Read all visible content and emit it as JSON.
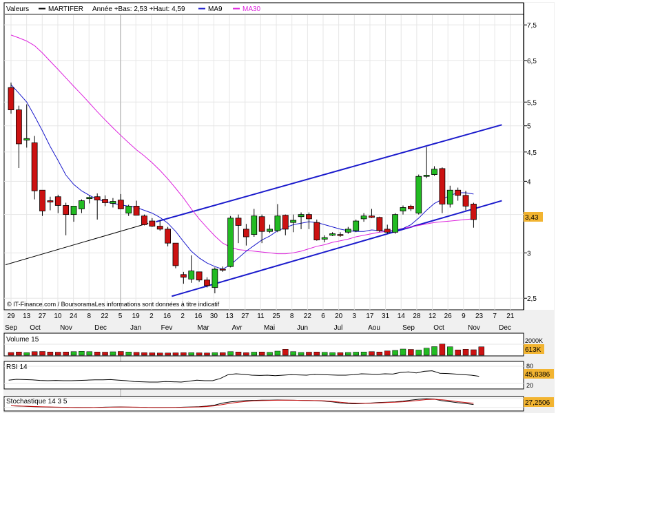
{
  "header": {
    "valeurs_label": "Valeurs",
    "symbol": "MARTIFER",
    "range_text": "Année +Bas: 2,53 +Haut: 4,59",
    "ma9_label": "MA9",
    "ma30_label": "MA30"
  },
  "colors": {
    "up": "#22bb22",
    "down": "#cc1111",
    "ma9": "#1a1acc",
    "ma30": "#dd22dd",
    "channel": "#1a1acc",
    "grid": "#e6e6e6",
    "badge_bg": "#f2b431",
    "panel_bg": "#ffffff",
    "frame_bg": "#f0f0f0"
  },
  "copyright": "© IT-Finance.com / BoursoramaLes informations sont données à titre indicatif",
  "price_axis": {
    "ticks": [
      2.5,
      3,
      3.5,
      4,
      4.5,
      5,
      5.5,
      6.5,
      7.5
    ],
    "labels": [
      "2,5",
      "3",
      "",
      "4",
      "4,5",
      "5",
      "5,5",
      "6,5",
      "7,5"
    ],
    "scale": "log",
    "last_value_label": "3,43"
  },
  "time_axis": {
    "day_labels": [
      "29",
      "13",
      "27",
      "10",
      "24",
      "8",
      "22",
      "5",
      "19",
      "2",
      "16",
      "2",
      "16",
      "30",
      "13",
      "27",
      "11",
      "25",
      "8",
      "22",
      "6",
      "20",
      "3",
      "17",
      "31",
      "14",
      "28",
      "12",
      "26",
      "9",
      "23",
      "7",
      "21"
    ],
    "month_labels": [
      "Sep",
      "Oct",
      "Nov",
      "Dec",
      "Jan",
      "Fev",
      "Mar",
      "Avr",
      "Mai",
      "Jun",
      "Jul",
      "Aou",
      "Sep",
      "Oct",
      "Nov",
      "Dec"
    ]
  },
  "chart_data": {
    "type": "candlestick",
    "title": "MARTIFER",
    "subtitle": "Année +Bas: 2,53 +Haut: 4,59",
    "ylim": [
      2.4,
      7.8
    ],
    "yscale": "log",
    "candles": [
      {
        "o": 5.83,
        "h": 5.95,
        "l": 5.25,
        "c": 5.33
      },
      {
        "o": 5.33,
        "h": 5.42,
        "l": 4.22,
        "c": 4.65
      },
      {
        "o": 4.72,
        "h": 5.45,
        "l": 4.58,
        "c": 4.75
      },
      {
        "o": 4.67,
        "h": 4.8,
        "l": 3.72,
        "c": 3.85
      },
      {
        "o": 3.86,
        "h": 3.86,
        "l": 3.48,
        "c": 3.55
      },
      {
        "o": 3.7,
        "h": 3.76,
        "l": 3.56,
        "c": 3.68
      },
      {
        "o": 3.76,
        "h": 3.79,
        "l": 3.52,
        "c": 3.63
      },
      {
        "o": 3.63,
        "h": 3.67,
        "l": 3.22,
        "c": 3.5
      },
      {
        "o": 3.5,
        "h": 3.6,
        "l": 3.4,
        "c": 3.62
      },
      {
        "o": 3.58,
        "h": 3.72,
        "l": 3.52,
        "c": 3.7
      },
      {
        "o": 3.73,
        "h": 3.78,
        "l": 3.66,
        "c": 3.75
      },
      {
        "o": 3.76,
        "h": 3.81,
        "l": 3.43,
        "c": 3.71
      },
      {
        "o": 3.72,
        "h": 3.78,
        "l": 3.62,
        "c": 3.67
      },
      {
        "o": 3.66,
        "h": 3.74,
        "l": 3.6,
        "c": 3.69
      },
      {
        "o": 3.71,
        "h": 3.8,
        "l": 3.58,
        "c": 3.58
      },
      {
        "o": 3.52,
        "h": 3.64,
        "l": 3.48,
        "c": 3.62
      },
      {
        "o": 3.62,
        "h": 3.7,
        "l": 3.52,
        "c": 3.49
      },
      {
        "o": 3.48,
        "h": 3.5,
        "l": 3.35,
        "c": 3.36
      },
      {
        "o": 3.41,
        "h": 3.45,
        "l": 3.33,
        "c": 3.34
      },
      {
        "o": 3.34,
        "h": 3.42,
        "l": 3.28,
        "c": 3.3
      },
      {
        "o": 3.3,
        "h": 3.33,
        "l": 3.08,
        "c": 3.12
      },
      {
        "o": 3.12,
        "h": 3.12,
        "l": 2.82,
        "c": 2.85
      },
      {
        "o": 2.75,
        "h": 2.78,
        "l": 2.65,
        "c": 2.72
      },
      {
        "o": 2.7,
        "h": 2.97,
        "l": 2.66,
        "c": 2.79
      },
      {
        "o": 2.78,
        "h": 2.78,
        "l": 2.67,
        "c": 2.69
      },
      {
        "o": 2.69,
        "h": 2.72,
        "l": 2.61,
        "c": 2.63
      },
      {
        "o": 2.61,
        "h": 2.83,
        "l": 2.55,
        "c": 2.81
      },
      {
        "o": 2.81,
        "h": 2.84,
        "l": 2.78,
        "c": 2.8
      },
      {
        "o": 2.84,
        "h": 3.48,
        "l": 2.83,
        "c": 3.45
      },
      {
        "o": 3.45,
        "h": 3.5,
        "l": 3.12,
        "c": 3.35
      },
      {
        "o": 3.3,
        "h": 3.37,
        "l": 3.09,
        "c": 3.2
      },
      {
        "o": 3.23,
        "h": 3.58,
        "l": 3.2,
        "c": 3.48
      },
      {
        "o": 3.47,
        "h": 3.5,
        "l": 3.12,
        "c": 3.27
      },
      {
        "o": 3.27,
        "h": 3.36,
        "l": 3.25,
        "c": 3.3
      },
      {
        "o": 3.28,
        "h": 3.65,
        "l": 3.26,
        "c": 3.48
      },
      {
        "o": 3.49,
        "h": 3.5,
        "l": 3.22,
        "c": 3.3
      },
      {
        "o": 3.39,
        "h": 3.5,
        "l": 3.26,
        "c": 3.42
      },
      {
        "o": 3.47,
        "h": 3.53,
        "l": 3.3,
        "c": 3.5
      },
      {
        "o": 3.5,
        "h": 3.53,
        "l": 3.3,
        "c": 3.44
      },
      {
        "o": 3.39,
        "h": 3.43,
        "l": 3.15,
        "c": 3.16
      },
      {
        "o": 3.17,
        "h": 3.22,
        "l": 3.13,
        "c": 3.19
      },
      {
        "o": 3.22,
        "h": 3.26,
        "l": 3.21,
        "c": 3.24
      },
      {
        "o": 3.23,
        "h": 3.26,
        "l": 3.2,
        "c": 3.22
      },
      {
        "o": 3.26,
        "h": 3.33,
        "l": 3.24,
        "c": 3.3
      },
      {
        "o": 3.28,
        "h": 3.43,
        "l": 3.26,
        "c": 3.41
      },
      {
        "o": 3.44,
        "h": 3.52,
        "l": 3.4,
        "c": 3.48
      },
      {
        "o": 3.48,
        "h": 3.58,
        "l": 3.45,
        "c": 3.46
      },
      {
        "o": 3.46,
        "h": 3.47,
        "l": 3.26,
        "c": 3.28
      },
      {
        "o": 3.3,
        "h": 3.36,
        "l": 3.24,
        "c": 3.26
      },
      {
        "o": 3.26,
        "h": 3.52,
        "l": 3.24,
        "c": 3.5
      },
      {
        "o": 3.55,
        "h": 3.63,
        "l": 3.5,
        "c": 3.6
      },
      {
        "o": 3.62,
        "h": 3.64,
        "l": 3.55,
        "c": 3.58
      },
      {
        "o": 3.52,
        "h": 4.11,
        "l": 3.5,
        "c": 4.08
      },
      {
        "o": 4.08,
        "h": 4.59,
        "l": 4.05,
        "c": 4.1
      },
      {
        "o": 4.11,
        "h": 4.25,
        "l": 4.09,
        "c": 4.2
      },
      {
        "o": 4.21,
        "h": 4.23,
        "l": 3.52,
        "c": 3.65
      },
      {
        "o": 3.65,
        "h": 3.93,
        "l": 3.6,
        "c": 3.86
      },
      {
        "o": 3.86,
        "h": 3.9,
        "l": 3.7,
        "c": 3.78
      },
      {
        "o": 3.78,
        "h": 3.85,
        "l": 3.56,
        "c": 3.62
      },
      {
        "o": 3.65,
        "h": 3.67,
        "l": 3.32,
        "c": 3.43
      }
    ],
    "ma9": [
      5.9,
      5.7,
      5.5,
      5.2,
      4.9,
      4.6,
      4.35,
      4.1,
      3.95,
      3.85,
      3.78,
      3.72,
      3.69,
      3.66,
      3.64,
      3.62,
      3.6,
      3.56,
      3.52,
      3.46,
      3.38,
      3.27,
      3.14,
      3.02,
      2.94,
      2.88,
      2.84,
      2.81,
      2.86,
      2.94,
      3.02,
      3.09,
      3.16,
      3.21,
      3.28,
      3.32,
      3.36,
      3.38,
      3.4,
      3.39,
      3.36,
      3.33,
      3.3,
      3.28,
      3.27,
      3.27,
      3.29,
      3.28,
      3.27,
      3.28,
      3.31,
      3.36,
      3.45,
      3.56,
      3.66,
      3.72,
      3.78,
      3.82,
      3.82,
      3.8
    ],
    "ma30": [
      7.2,
      7.12,
      7.03,
      6.9,
      6.7,
      6.48,
      6.27,
      6.06,
      5.86,
      5.67,
      5.48,
      5.29,
      5.12,
      4.96,
      4.81,
      4.67,
      4.54,
      4.43,
      4.31,
      4.18,
      4.04,
      3.89,
      3.74,
      3.58,
      3.44,
      3.32,
      3.21,
      3.12,
      3.07,
      3.04,
      3.03,
      3.02,
      3.01,
      3.0,
      2.99,
      2.99,
      3.0,
      3.02,
      3.05,
      3.08,
      3.1,
      3.13,
      3.15,
      3.17,
      3.2,
      3.22,
      3.24,
      3.26,
      3.27,
      3.29,
      3.31,
      3.33,
      3.35,
      3.37,
      3.39,
      3.4,
      3.41,
      3.42,
      3.43,
      3.44
    ],
    "trendlines": [
      {
        "from": {
          "i": -0.7,
          "v": 2.86
        },
        "to": {
          "i": 17.5,
          "v": 3.38
        },
        "style": "thin-black"
      },
      {
        "from": {
          "i": 18.5,
          "v": 3.4
        },
        "to": {
          "i": 62.6,
          "v": 5.02
        },
        "style": "channel-upper"
      },
      {
        "from": {
          "i": 20.5,
          "v": 2.52
        },
        "to": {
          "i": 62.6,
          "v": 3.7
        },
        "style": "channel-lower"
      }
    ],
    "volume": {
      "label": "Volume 15",
      "max_label": "2000K",
      "last_label": "613K",
      "values": [
        320,
        380,
        300,
        420,
        440,
        380,
        360,
        380,
        420,
        460,
        420,
        380,
        360,
        400,
        440,
        380,
        340,
        300,
        280,
        260,
        260,
        280,
        300,
        300,
        280,
        260,
        300,
        300,
        420,
        380,
        300,
        360,
        380,
        340,
        480,
        700,
        420,
        320,
        360,
        380,
        340,
        300,
        300,
        320,
        360,
        380,
        420,
        380,
        500,
        560,
        720,
        680,
        600,
        820,
        1000,
        1300,
        980,
        620,
        700,
        640,
        980
      ]
    },
    "rsi": {
      "label": "RSI 14",
      "levels": [
        20,
        80
      ],
      "level_labels": [
        "20",
        "80"
      ],
      "last_label": "45,8386",
      "values": [
        32,
        35,
        34,
        33,
        31,
        30,
        31,
        30,
        30,
        31,
        32,
        33,
        33,
        34,
        32,
        30,
        27,
        26,
        25,
        25,
        27,
        26,
        25,
        28,
        32,
        30,
        30,
        38,
        52,
        55,
        53,
        50,
        49,
        50,
        48,
        50,
        52,
        51,
        50,
        53,
        52,
        51,
        50,
        50,
        52,
        55,
        54,
        53,
        55,
        54,
        60,
        62,
        58,
        64,
        66,
        57,
        56,
        54,
        52,
        50,
        46
      ]
    },
    "stochastic": {
      "label": "Stochastique 14 3 5",
      "last_label": "27,2506",
      "k": [
        35,
        32,
        30,
        28,
        26,
        24,
        23,
        22,
        20,
        19,
        20,
        22,
        24,
        25,
        26,
        24,
        23,
        22,
        20,
        20,
        21,
        22,
        24,
        26,
        28,
        32,
        40,
        55,
        64,
        70,
        74,
        76,
        78,
        78,
        79,
        78,
        77,
        76,
        75,
        73,
        70,
        64,
        56,
        52,
        50,
        52,
        56,
        60,
        62,
        64,
        70,
        78,
        84,
        88,
        86,
        72,
        66,
        58,
        52,
        44
      ],
      "d": [
        34,
        33,
        31,
        29,
        27,
        26,
        24,
        23,
        21,
        20,
        20,
        21,
        22,
        24,
        25,
        25,
        24,
        23,
        21,
        20,
        20,
        21,
        22,
        24,
        26,
        29,
        34,
        44,
        54,
        62,
        68,
        72,
        74,
        76,
        77,
        78,
        77,
        76,
        75,
        74,
        72,
        68,
        62,
        57,
        54,
        53,
        54,
        57,
        60,
        62,
        65,
        70,
        76,
        82,
        84,
        80,
        74,
        66,
        60,
        54
      ]
    },
    "xlabel": "",
    "ylabel": ""
  }
}
